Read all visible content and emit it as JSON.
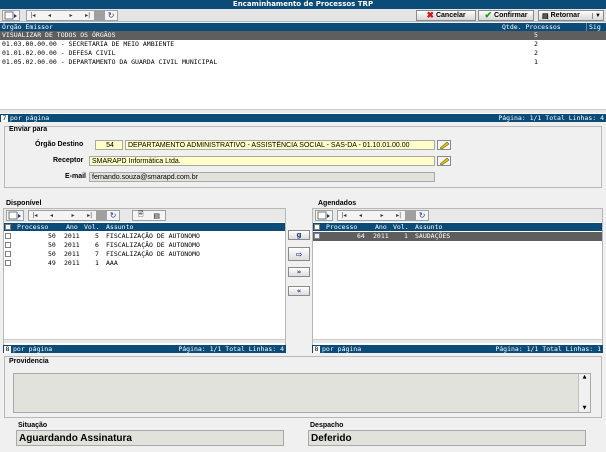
{
  "window": {
    "title": "Encaminhamento de Processos TRP"
  },
  "toolbar": {
    "cancel_label": "Cancelar",
    "confirm_label": "Confirmar",
    "return_label": "Retornar"
  },
  "emissor_grid": {
    "headers": [
      "Órgão Emissor",
      "Qtde. Processos",
      "Sig"
    ],
    "rows": [
      {
        "orgao": "VISUALIZAR DE TODOS OS ÓRGÃOS",
        "qtde": "5"
      },
      {
        "orgao": "01.03.00.00.00 - SECRETARIA DE MEIO AMBIENTE",
        "qtde": "2"
      },
      {
        "orgao": "01.01.02.00.00 - DEFESA CIVIL",
        "qtde": "2"
      },
      {
        "orgao": "01.05.02.00.00 - DEPARTAMENTO DA GUARDA CIVIL MUNICIPAL",
        "qtde": "1"
      }
    ],
    "footer": {
      "per_page": "7",
      "per_page_label": "por página",
      "pagination": "Página: 1/1 Total Linhas: 4"
    }
  },
  "enviar": {
    "section_title": "Enviar para",
    "orgao_label": "Órgão Destino",
    "orgao_code": "54",
    "orgao_name": "DEPARTAMENTO ADMINISTRATIVO - ASSISTÊNCIA SOCIAL - SAS-DA - 01.10.01.00.00",
    "receptor_label": "Receptor",
    "receptor_value": "SMARAPD Informática Ltda.",
    "email_label": "E-mail",
    "email_value": "fernando.souza@smarapd.com.br"
  },
  "disponivel": {
    "section_title": "Disponível",
    "headers": [
      "Processo",
      "Ano",
      "Vol.",
      "Assunto"
    ],
    "rows": [
      {
        "processo": "50",
        "ano": "2011",
        "vol": "5",
        "assunto": "FISCALIZAÇÃO DE AUTONOMO"
      },
      {
        "processo": "50",
        "ano": "2011",
        "vol": "6",
        "assunto": "FISCALIZAÇÃO DE AUTONOMO"
      },
      {
        "processo": "50",
        "ano": "2011",
        "vol": "7",
        "assunto": "FISCALIZAÇÃO DE AUTONOMO"
      },
      {
        "processo": "49",
        "ano": "2011",
        "vol": "1",
        "assunto": "AAA"
      }
    ],
    "footer": {
      "per_page": "8",
      "per_page_label": "por página",
      "pagination": "Página: 1/1 Total Linhas: 4"
    }
  },
  "move_buttons": {
    "first": "g",
    "add_all": "»",
    "remove_all": "«"
  },
  "agendados": {
    "section_title": "Agendados",
    "headers": [
      "Processo",
      "Ano",
      "Vol.",
      "Assunto"
    ],
    "rows": [
      {
        "processo": "64",
        "ano": "2011",
        "vol": "1",
        "assunto": "SAUDAÇÕES"
      }
    ],
    "footer": {
      "per_page": "8",
      "per_page_label": "por página",
      "pagination": "Página: 1/1 Total Linhas: 1"
    }
  },
  "providencia": {
    "section_title": "Providencia",
    "value": ""
  },
  "situacao": {
    "label": "Situação",
    "value": "Aguardando Assinatura"
  },
  "despacho": {
    "label": "Despacho",
    "value": "Deferido"
  },
  "colors": {
    "header_blue": "#0a4b78",
    "selected_row": "#5e5e5e",
    "input_yellow": "#ffffc8"
  }
}
